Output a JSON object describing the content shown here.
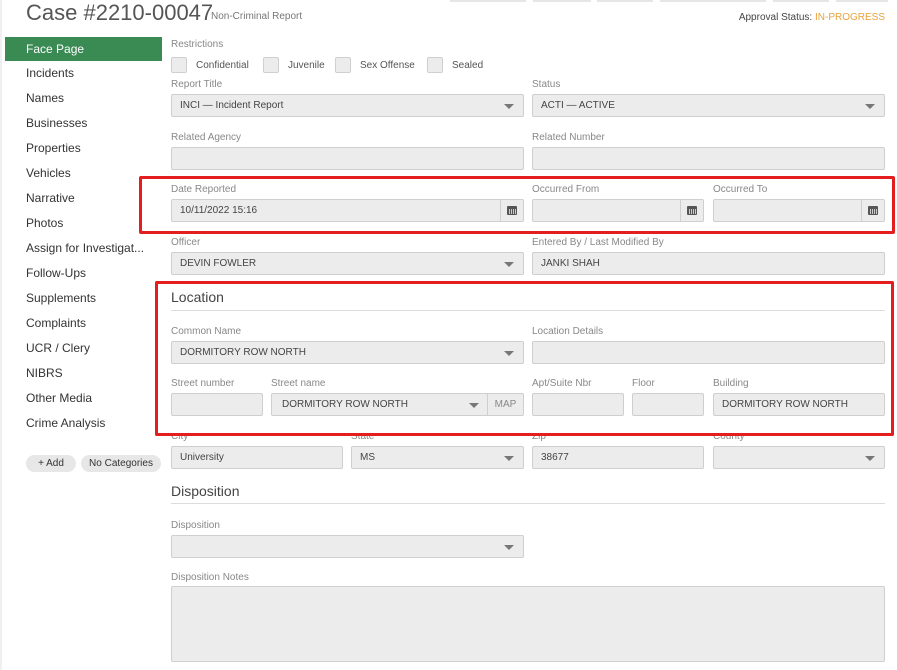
{
  "header": {
    "case_title": "Case #2210-00047",
    "case_subtitle": "Non-Criminal Report",
    "approval_label": "Approval Status:",
    "approval_value": "IN-PROGRESS"
  },
  "sidebar": {
    "items": [
      {
        "label": "Face Page",
        "active": true
      },
      {
        "label": "Incidents"
      },
      {
        "label": "Names"
      },
      {
        "label": "Businesses"
      },
      {
        "label": "Properties"
      },
      {
        "label": "Vehicles"
      },
      {
        "label": "Narrative"
      },
      {
        "label": "Photos"
      },
      {
        "label": "Assign for Investigat..."
      },
      {
        "label": "Follow-Ups"
      },
      {
        "label": "Supplements"
      },
      {
        "label": "Complaints"
      },
      {
        "label": "UCR / Clery"
      },
      {
        "label": "NIBRS"
      },
      {
        "label": "Other Media"
      },
      {
        "label": "Crime Analysis"
      }
    ],
    "add_label": "+ Add",
    "categories_label": "No Categories"
  },
  "restrictions": {
    "label": "Restrictions",
    "options": [
      "Confidential",
      "Juvenile",
      "Sex Offense",
      "Sealed"
    ]
  },
  "report_title": {
    "label": "Report Title",
    "value": "INCI — Incident Report"
  },
  "status": {
    "label": "Status",
    "value": "ACTI — ACTIVE"
  },
  "related_agency": {
    "label": "Related Agency",
    "value": ""
  },
  "related_number": {
    "label": "Related Number",
    "value": ""
  },
  "date_reported": {
    "label": "Date Reported",
    "value": "10/11/2022 15:16"
  },
  "occurred_from": {
    "label": "Occurred From",
    "value": ""
  },
  "occurred_to": {
    "label": "Occurred To",
    "value": ""
  },
  "officer": {
    "label": "Officer",
    "value": "DEVIN FOWLER"
  },
  "entered_by": {
    "label": "Entered By / Last Modified By",
    "value": "JANKI SHAH"
  },
  "location": {
    "title": "Location",
    "common_name": {
      "label": "Common Name",
      "value": "DORMITORY ROW NORTH"
    },
    "location_details": {
      "label": "Location Details",
      "value": ""
    },
    "street_number": {
      "label": "Street number",
      "value": ""
    },
    "street_name": {
      "label": "Street name",
      "value": "DORMITORY ROW NORTH",
      "map_label": "MAP"
    },
    "apt_suite": {
      "label": "Apt/Suite Nbr",
      "value": ""
    },
    "floor": {
      "label": "Floor",
      "value": ""
    },
    "building": {
      "label": "Building",
      "value": "DORMITORY ROW NORTH"
    },
    "city": {
      "label": "City",
      "value": "University"
    },
    "state": {
      "label": "State",
      "value": "MS"
    },
    "zip": {
      "label": "Zip",
      "value": "38677"
    },
    "county": {
      "label": "County",
      "value": ""
    }
  },
  "disposition": {
    "title": "Disposition",
    "field_label": "Disposition",
    "value": "",
    "notes_label": "Disposition Notes",
    "notes_value": ""
  },
  "colors": {
    "accent": "#3a8a53",
    "highlight": "#e41e1e",
    "status": "#e8a33a"
  }
}
